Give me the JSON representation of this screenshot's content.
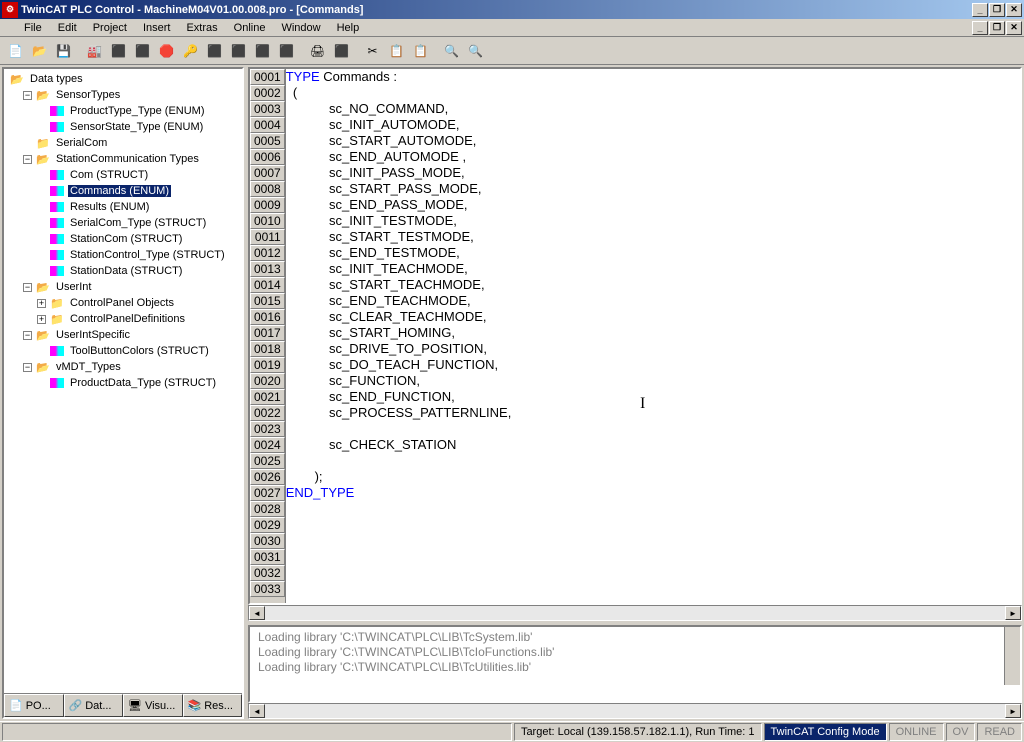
{
  "title": "TwinCAT PLC Control - MachineM04V01.00.008.pro - [Commands]",
  "menu": [
    "File",
    "Edit",
    "Project",
    "Insert",
    "Extras",
    "Online",
    "Window",
    "Help"
  ],
  "tree": {
    "root": "Data types",
    "nodes": [
      {
        "level": 2,
        "exp": "-",
        "icon": "folder-open",
        "label": "SensorTypes"
      },
      {
        "level": 3,
        "exp": "",
        "icon": "enum",
        "label": "ProductType_Type (ENUM)"
      },
      {
        "level": 3,
        "exp": "",
        "icon": "enum",
        "label": "SensorState_Type (ENUM)"
      },
      {
        "level": 2,
        "exp": "",
        "icon": "folder",
        "label": "SerialCom"
      },
      {
        "level": 2,
        "exp": "-",
        "icon": "folder-open",
        "label": "StationCommunication Types"
      },
      {
        "level": 3,
        "exp": "",
        "icon": "enum",
        "label": "Com (STRUCT)"
      },
      {
        "level": 3,
        "exp": "",
        "icon": "enum",
        "label": "Commands (ENUM)",
        "sel": true
      },
      {
        "level": 3,
        "exp": "",
        "icon": "enum",
        "label": "Results (ENUM)"
      },
      {
        "level": 3,
        "exp": "",
        "icon": "enum",
        "label": "SerialCom_Type (STRUCT)"
      },
      {
        "level": 3,
        "exp": "",
        "icon": "enum",
        "label": "StationCom (STRUCT)"
      },
      {
        "level": 3,
        "exp": "",
        "icon": "enum",
        "label": "StationControl_Type (STRUCT)"
      },
      {
        "level": 3,
        "exp": "",
        "icon": "enum",
        "label": "StationData (STRUCT)"
      },
      {
        "level": 2,
        "exp": "-",
        "icon": "folder-open",
        "label": "UserInt"
      },
      {
        "level": 3,
        "exp": "+",
        "icon": "folder",
        "label": "ControlPanel Objects"
      },
      {
        "level": 3,
        "exp": "+",
        "icon": "folder",
        "label": "ControlPanelDefinitions"
      },
      {
        "level": 2,
        "exp": "-",
        "icon": "folder-open",
        "label": "UserIntSpecific"
      },
      {
        "level": 3,
        "exp": "",
        "icon": "enum",
        "label": "ToolButtonColors (STRUCT)"
      },
      {
        "level": 2,
        "exp": "-",
        "icon": "folder-open",
        "label": "vMDT_Types"
      },
      {
        "level": 3,
        "exp": "",
        "icon": "enum",
        "label": "ProductData_Type (STRUCT)"
      }
    ]
  },
  "tabs": [
    {
      "icon": "📄",
      "label": "PO..."
    },
    {
      "icon": "🔗",
      "label": "Dat..."
    },
    {
      "icon": "🖥",
      "label": "Visu..."
    },
    {
      "icon": "📚",
      "label": "Res..."
    }
  ],
  "code": [
    {
      "n": "0001",
      "pre": "",
      "kw": "TYPE",
      "rest": " Commands :"
    },
    {
      "n": "0002",
      "pre": "  (",
      "kw": "",
      "rest": ""
    },
    {
      "n": "0003",
      "pre": "            sc_NO_COMMAND,",
      "kw": "",
      "rest": ""
    },
    {
      "n": "0004",
      "pre": "            sc_INIT_AUTOMODE,",
      "kw": "",
      "rest": ""
    },
    {
      "n": "0005",
      "pre": "            sc_START_AUTOMODE,",
      "kw": "",
      "rest": ""
    },
    {
      "n": "0006",
      "pre": "            sc_END_AUTOMODE ,",
      "kw": "",
      "rest": ""
    },
    {
      "n": "0007",
      "pre": "            sc_INIT_PASS_MODE,",
      "kw": "",
      "rest": ""
    },
    {
      "n": "0008",
      "pre": "            sc_START_PASS_MODE,",
      "kw": "",
      "rest": ""
    },
    {
      "n": "0009",
      "pre": "            sc_END_PASS_MODE,",
      "kw": "",
      "rest": ""
    },
    {
      "n": "0010",
      "pre": "            sc_INIT_TESTMODE,",
      "kw": "",
      "rest": ""
    },
    {
      "n": "0011",
      "pre": "            sc_START_TESTMODE,",
      "kw": "",
      "rest": ""
    },
    {
      "n": "0012",
      "pre": "            sc_END_TESTMODE,",
      "kw": "",
      "rest": ""
    },
    {
      "n": "0013",
      "pre": "            sc_INIT_TEACHMODE,",
      "kw": "",
      "rest": ""
    },
    {
      "n": "0014",
      "pre": "            sc_START_TEACHMODE,",
      "kw": "",
      "rest": ""
    },
    {
      "n": "0015",
      "pre": "            sc_END_TEACHMODE,",
      "kw": "",
      "rest": ""
    },
    {
      "n": "0016",
      "pre": "            sc_CLEAR_TEACHMODE,",
      "kw": "",
      "rest": ""
    },
    {
      "n": "0017",
      "pre": "            sc_START_HOMING,",
      "kw": "",
      "rest": ""
    },
    {
      "n": "0018",
      "pre": "            sc_DRIVE_TO_POSITION,",
      "kw": "",
      "rest": ""
    },
    {
      "n": "0019",
      "pre": "            sc_DO_TEACH_FUNCTION,",
      "kw": "",
      "rest": ""
    },
    {
      "n": "0020",
      "pre": "            sc_FUNCTION,",
      "kw": "",
      "rest": ""
    },
    {
      "n": "0021",
      "pre": "            sc_END_FUNCTION,",
      "kw": "",
      "rest": ""
    },
    {
      "n": "0022",
      "pre": "            sc_PROCESS_PATTERNLINE,",
      "kw": "",
      "rest": ""
    },
    {
      "n": "0023",
      "pre": "",
      "kw": "",
      "rest": ""
    },
    {
      "n": "0024",
      "pre": "            sc_CHECK_STATION",
      "kw": "",
      "rest": ""
    },
    {
      "n": "0025",
      "pre": "",
      "kw": "",
      "rest": ""
    },
    {
      "n": "0026",
      "pre": "        );",
      "kw": "",
      "rest": ""
    },
    {
      "n": "0027",
      "pre": "",
      "kw": "END_TYPE",
      "rest": ""
    },
    {
      "n": "0028",
      "pre": "",
      "kw": "",
      "rest": ""
    },
    {
      "n": "0029",
      "pre": "",
      "kw": "",
      "rest": ""
    },
    {
      "n": "0030",
      "pre": "",
      "kw": "",
      "rest": ""
    },
    {
      "n": "0031",
      "pre": "",
      "kw": "",
      "rest": ""
    },
    {
      "n": "0032",
      "pre": "",
      "kw": "",
      "rest": ""
    },
    {
      "n": "0033",
      "pre": "",
      "kw": "",
      "rest": ""
    }
  ],
  "messages": [
    "Loading library 'C:\\TWINCAT\\PLC\\LIB\\TcSystem.lib'",
    "Loading library 'C:\\TWINCAT\\PLC\\LIB\\TcIoFunctions.lib'",
    "Loading library 'C:\\TWINCAT\\PLC\\LIB\\TcUtilities.lib'"
  ],
  "status": {
    "target": "Target: Local (139.158.57.182.1.1), Run Time: 1",
    "mode": "TwinCAT Config Mode",
    "online": "ONLINE",
    "ov": "OV",
    "read": "READ"
  },
  "toolbar_icons": [
    "📄",
    "📂",
    "💾",
    "",
    "🏭",
    "⬛",
    "⬛",
    "🛑",
    "🔑",
    "⬛",
    "⬛",
    "⬛",
    "⬛",
    "",
    "🖨",
    "⬛",
    "",
    "✂",
    "📋",
    "📋",
    "",
    "🔍",
    "🔍"
  ]
}
